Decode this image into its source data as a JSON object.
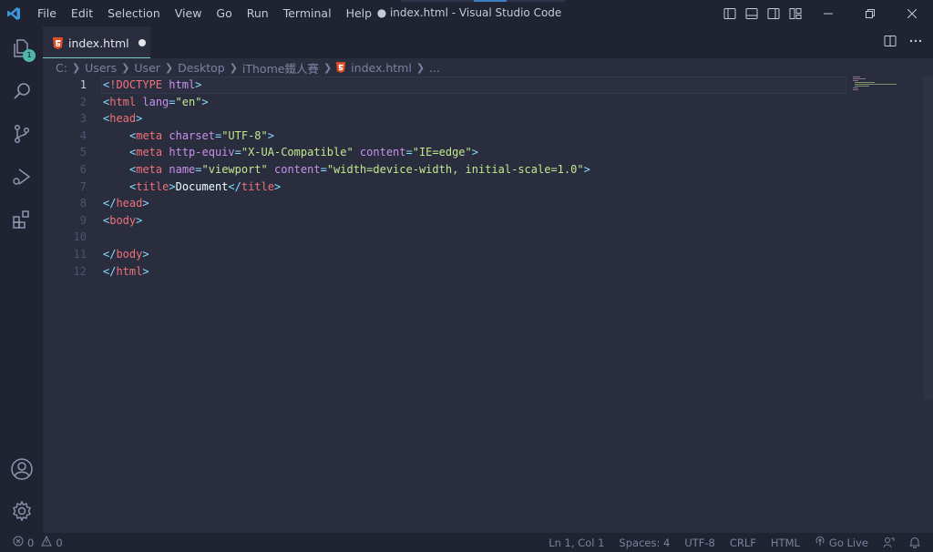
{
  "titlebar": {
    "menu": [
      "File",
      "Edit",
      "Selection",
      "View",
      "Go",
      "Run",
      "Terminal",
      "Help"
    ],
    "window_title": "● index.html - Visual Studio Code"
  },
  "activitybar": {
    "items": [
      "explorer-icon",
      "search-icon",
      "source-control-icon",
      "run-debug-icon",
      "extensions-icon"
    ],
    "explorer_badge": "1",
    "bottom": [
      "account-icon",
      "settings-gear-icon"
    ]
  },
  "tab": {
    "label": "index.html",
    "dirty": true
  },
  "breadcrumb": {
    "parts": [
      "C:",
      "Users",
      "User",
      "Desktop",
      "iThome鐵人賽"
    ],
    "file": "index.html",
    "tail": "..."
  },
  "editor": {
    "line_numbers": [
      "1",
      "2",
      "3",
      "4",
      "5",
      "6",
      "7",
      "8",
      "9",
      "10",
      "11",
      "12"
    ],
    "active_line": "1",
    "colors": {
      "bracket": "#89ddff",
      "tag": "#f07178",
      "doctype": "#c792ea",
      "attr": "#c792ea",
      "string": "#c3e88d",
      "text": "#eeffff"
    },
    "lines": [
      {
        "indent": 0,
        "tokens": [
          [
            "bracket",
            "<"
          ],
          [
            "tag",
            "!DOCTYPE"
          ],
          [
            "text",
            " "
          ],
          [
            "attr",
            "html"
          ],
          [
            "bracket",
            ">"
          ]
        ]
      },
      {
        "indent": 0,
        "tokens": [
          [
            "bracket",
            "<"
          ],
          [
            "tag",
            "html"
          ],
          [
            "text",
            " "
          ],
          [
            "attr",
            "lang"
          ],
          [
            "bracket",
            "="
          ],
          [
            "string",
            "\"en\""
          ],
          [
            "bracket",
            ">"
          ]
        ]
      },
      {
        "indent": 0,
        "tokens": [
          [
            "bracket",
            "<"
          ],
          [
            "tag",
            "head"
          ],
          [
            "bracket",
            ">"
          ]
        ]
      },
      {
        "indent": 1,
        "tokens": [
          [
            "bracket",
            "<"
          ],
          [
            "tag",
            "meta"
          ],
          [
            "text",
            " "
          ],
          [
            "attr",
            "charset"
          ],
          [
            "bracket",
            "="
          ],
          [
            "string",
            "\"UTF-8\""
          ],
          [
            "bracket",
            ">"
          ]
        ]
      },
      {
        "indent": 1,
        "tokens": [
          [
            "bracket",
            "<"
          ],
          [
            "tag",
            "meta"
          ],
          [
            "text",
            " "
          ],
          [
            "attr",
            "http-equiv"
          ],
          [
            "bracket",
            "="
          ],
          [
            "string",
            "\"X-UA-Compatible\""
          ],
          [
            "text",
            " "
          ],
          [
            "attr",
            "content"
          ],
          [
            "bracket",
            "="
          ],
          [
            "string",
            "\"IE=edge\""
          ],
          [
            "bracket",
            ">"
          ]
        ]
      },
      {
        "indent": 1,
        "tokens": [
          [
            "bracket",
            "<"
          ],
          [
            "tag",
            "meta"
          ],
          [
            "text",
            " "
          ],
          [
            "attr",
            "name"
          ],
          [
            "bracket",
            "="
          ],
          [
            "string",
            "\"viewport\""
          ],
          [
            "text",
            " "
          ],
          [
            "attr",
            "content"
          ],
          [
            "bracket",
            "="
          ],
          [
            "string",
            "\"width=device-width, initial-scale=1.0\""
          ],
          [
            "bracket",
            ">"
          ]
        ]
      },
      {
        "indent": 1,
        "tokens": [
          [
            "bracket",
            "<"
          ],
          [
            "tag",
            "title"
          ],
          [
            "bracket",
            ">"
          ],
          [
            "text",
            "Document"
          ],
          [
            "bracket",
            "</"
          ],
          [
            "tag",
            "title"
          ],
          [
            "bracket",
            ">"
          ]
        ]
      },
      {
        "indent": 0,
        "tokens": [
          [
            "bracket",
            "</"
          ],
          [
            "tag",
            "head"
          ],
          [
            "bracket",
            ">"
          ]
        ]
      },
      {
        "indent": 0,
        "tokens": [
          [
            "bracket",
            "<"
          ],
          [
            "tag",
            "body"
          ],
          [
            "bracket",
            ">"
          ]
        ]
      },
      {
        "indent": 0,
        "tokens": []
      },
      {
        "indent": 0,
        "tokens": [
          [
            "bracket",
            "</"
          ],
          [
            "tag",
            "body"
          ],
          [
            "bracket",
            ">"
          ]
        ]
      },
      {
        "indent": 0,
        "tokens": [
          [
            "bracket",
            "</"
          ],
          [
            "tag",
            "html"
          ],
          [
            "bracket",
            ">"
          ]
        ]
      }
    ]
  },
  "statusbar": {
    "errors": "0",
    "warnings": "0",
    "position": "Ln 1, Col 1",
    "spaces": "Spaces: 4",
    "encoding": "UTF-8",
    "eol": "CRLF",
    "language": "HTML",
    "go_live": "Go Live"
  }
}
